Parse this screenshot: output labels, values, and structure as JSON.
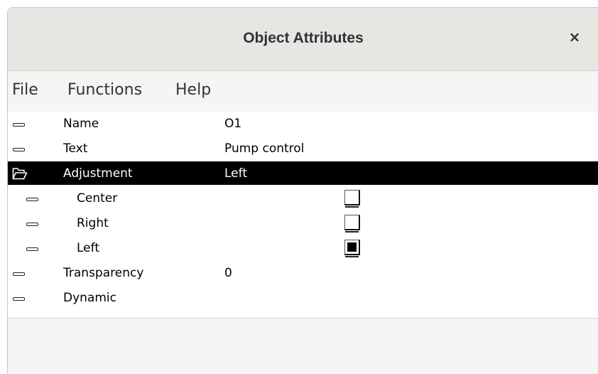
{
  "window": {
    "title": "Object Attributes",
    "close_glyph": "×"
  },
  "menu": {
    "file": "File",
    "functions": "Functions",
    "help": "Help"
  },
  "attributes": {
    "name": {
      "label": "Name",
      "value": "O1"
    },
    "text": {
      "label": "Text",
      "value": "Pump control"
    },
    "adjustment": {
      "label": "Adjustment",
      "value": "Left",
      "options": {
        "center": {
          "label": "Center",
          "checked": false
        },
        "right": {
          "label": "Right",
          "checked": false
        },
        "left": {
          "label": "Left",
          "checked": true
        }
      }
    },
    "transparency": {
      "label": "Transparency",
      "value": "0"
    },
    "dynamic": {
      "label": "Dynamic",
      "value": ""
    }
  },
  "icons": {
    "leaf": "dash-icon",
    "open_folder": "open-folder-icon"
  },
  "colors": {
    "selected_bg": "#000000",
    "selected_fg": "#ffffff"
  }
}
